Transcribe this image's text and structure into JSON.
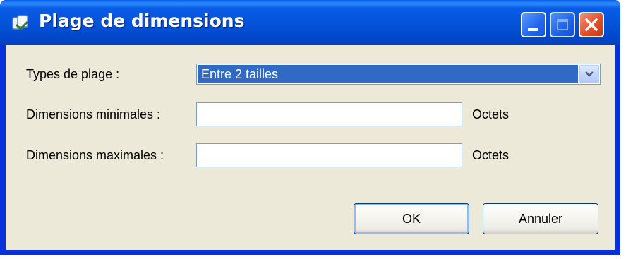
{
  "window": {
    "title": "Plage de dimensions",
    "icon": "app-icon",
    "controls": {
      "minimize": "minimize-icon",
      "maximize": "maximize-icon",
      "close": "close-icon"
    }
  },
  "form": {
    "range_type_label": "Types de plage :",
    "range_type_value": "Entre 2 tailles",
    "min_label": "Dimensions minimales :",
    "min_value": "",
    "min_unit": "Octets",
    "max_label": "Dimensions maximales :",
    "max_value": "",
    "max_unit": "Octets"
  },
  "buttons": {
    "ok": "OK",
    "cancel": "Annuler"
  },
  "colors": {
    "titlebar": "#0352d8",
    "selection": "#316ac5",
    "dialog_bg": "#ece9d8",
    "close_button": "#e2502a"
  }
}
